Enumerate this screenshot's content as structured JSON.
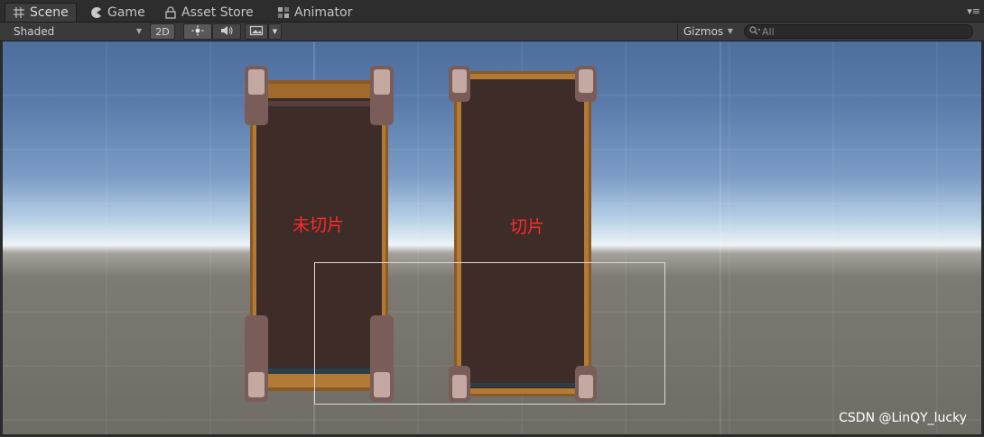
{
  "tabs": [
    {
      "label": "Scene",
      "icon": "scene-grid-icon"
    },
    {
      "label": "Game",
      "icon": "game-pacman-icon"
    },
    {
      "label": "Asset Store",
      "icon": "asset-store-lock-icon"
    },
    {
      "label": "Animator",
      "icon": "animator-grid-icon"
    }
  ],
  "toolbar": {
    "shading_mode": "Shaded",
    "mode_2d": "2D",
    "gizmos": "Gizmos",
    "search_placeholder": "All"
  },
  "scene": {
    "left_panel_label": "未切片",
    "right_panel_label": "切片"
  },
  "watermark": "CSDN @LinQY_lucky",
  "colors": {
    "panel_fill": "#3c2b27",
    "panel_border": "#a8702e",
    "label": "#ff2a2a",
    "sky_top": "#4e6e9e",
    "ground": "#6f6c66"
  }
}
